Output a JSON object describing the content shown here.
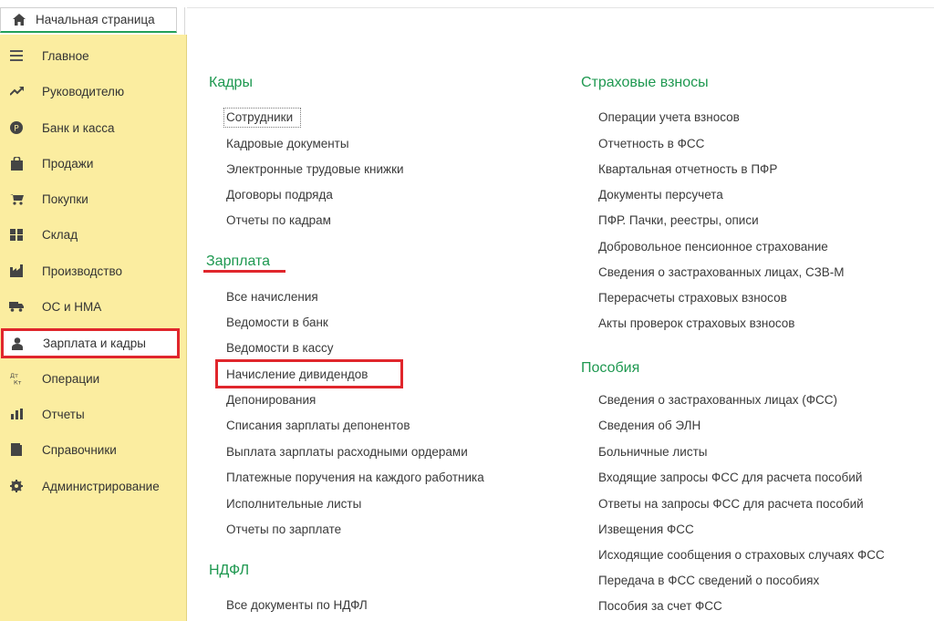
{
  "home_tab": {
    "label": "Начальная страница",
    "icon": "home-icon"
  },
  "sidebar": {
    "items": [
      {
        "label": "Главное",
        "icon": "menu-lines-icon"
      },
      {
        "label": "Руководителю",
        "icon": "trend-icon"
      },
      {
        "label": "Банк и касса",
        "icon": "coin-icon"
      },
      {
        "label": "Продажи",
        "icon": "shopping-bag-icon"
      },
      {
        "label": "Покупки",
        "icon": "cart-icon"
      },
      {
        "label": "Склад",
        "icon": "warehouse-icon"
      },
      {
        "label": "Производство",
        "icon": "factory-icon"
      },
      {
        "label": "ОС и НМА",
        "icon": "truck-icon"
      },
      {
        "label": "Зарплата и кадры",
        "icon": "person-icon",
        "active": true
      },
      {
        "label": "Операции",
        "icon": "dt-kt-icon"
      },
      {
        "label": "Отчеты",
        "icon": "bar-chart-icon"
      },
      {
        "label": "Справочники",
        "icon": "book-icon"
      },
      {
        "label": "Администрирование",
        "icon": "gear-icon"
      }
    ]
  },
  "sections": {
    "kadry": {
      "title": "Кадры",
      "links": [
        "Сотрудники",
        "Кадровые документы",
        "Электронные трудовые книжки",
        "Договоры подряда",
        "Отчеты по кадрам"
      ]
    },
    "zarplata": {
      "title": "Зарплата",
      "links": [
        "Все начисления",
        "Ведомости в банк",
        "Ведомости в кассу",
        "Начисление дивидендов",
        "Депонирования",
        "Списания зарплаты депонентов",
        "Выплата зарплаты расходными ордерами",
        "Платежные поручения на каждого работника",
        "Исполнительные листы",
        "Отчеты по зарплате"
      ]
    },
    "ndfl": {
      "title": "НДФЛ",
      "links": [
        "Все документы по НДФЛ"
      ]
    },
    "vznosy": {
      "title": "Страховые взносы",
      "links": [
        "Операции учета взносов",
        "Отчетность в ФСС",
        "Квартальная отчетность в ПФР",
        "Документы персучета",
        "ПФР. Пачки, реестры, описи",
        "Добровольное пенсионное страхование",
        "Сведения о застрахованных лицах, СЗВ-М",
        "Перерасчеты страховых взносов",
        "Акты проверок страховых взносов"
      ]
    },
    "posobiya": {
      "title": "Пособия",
      "links": [
        "Сведения о застрахованных лицах (ФСС)",
        "Сведения об ЭЛН",
        "Больничные листы",
        "Входящие запросы ФСС для расчета пособий",
        "Ответы на запросы ФСС для расчета пособий",
        "Извещения ФСС",
        "Исходящие сообщения о страховых случаях ФСС",
        "Передача в ФСС сведений о пособиях",
        "Пособия за счет ФСС"
      ]
    }
  },
  "colors": {
    "sidebar_bg": "#fbeda0",
    "section_title": "#1e9850",
    "highlight": "#e0262c"
  }
}
